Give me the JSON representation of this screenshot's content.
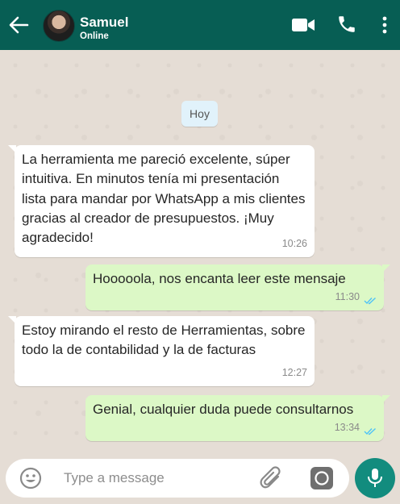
{
  "header": {
    "contact_name": "Samuel",
    "status": "Online",
    "icons": [
      "back-arrow-icon",
      "video-call-icon",
      "phone-call-icon",
      "more-vertical-icon"
    ],
    "bg_color": "#075e54"
  },
  "chat": {
    "date_chip": "Hoy",
    "messages": [
      {
        "direction": "incoming",
        "text": "La herramienta me pareció excelente, súper intuitiva. En minutos tenía mi presentación lista para mandar por WhatsApp a mis clientes gracias al creador de presupuestos. ¡Muy agradecido!",
        "time": "10:26"
      },
      {
        "direction": "outgoing",
        "text": "Hooooola, nos encanta leer este mensaje",
        "time": "11:30",
        "read": true
      },
      {
        "direction": "incoming",
        "text": "Estoy mirando el resto de Herramientas, sobre todo la de contabilidad y la de facturas",
        "time": "12:27"
      },
      {
        "direction": "outgoing",
        "text": "Genial, cualquier duda puede consultarnos",
        "time": "13:34",
        "read": true
      }
    ],
    "colors": {
      "incoming": "#ffffff",
      "outgoing": "#dcf8c6",
      "read_ticks": "#4fc3f7"
    }
  },
  "composer": {
    "placeholder": "Type a message",
    "value": "",
    "icons": [
      "emoji-icon",
      "attach-icon",
      "camera-icon",
      "microphone-icon"
    ],
    "mic_color": "#128c7e"
  }
}
